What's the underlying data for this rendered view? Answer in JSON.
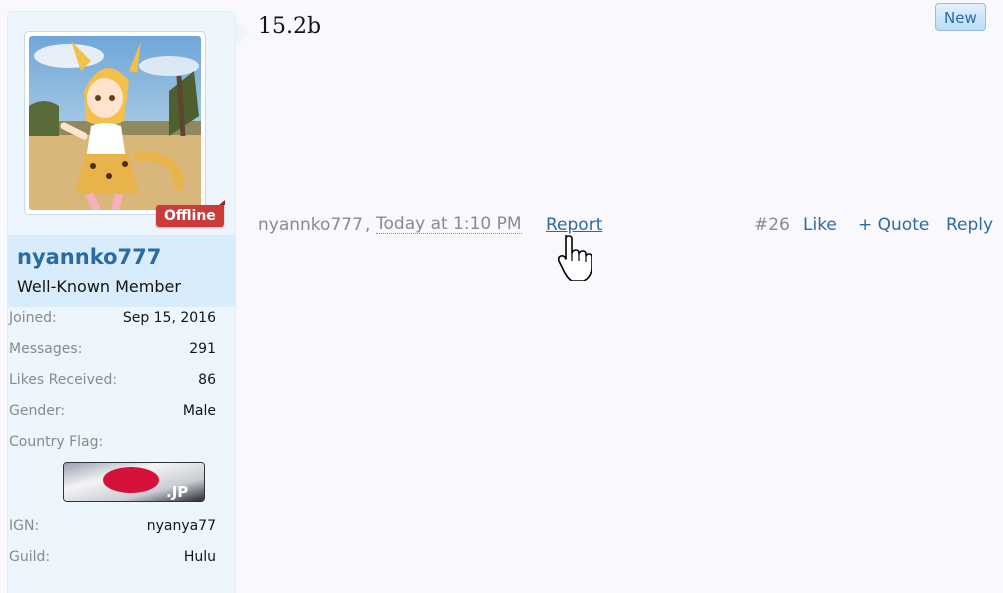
{
  "user": {
    "username": "nyannko777",
    "title": "Well-Known Member",
    "status_badge": "Offline",
    "extras": [
      {
        "label": "Joined:",
        "value": "Sep 15, 2016"
      },
      {
        "label": "Messages:",
        "value": "291"
      },
      {
        "label": "Likes Received:",
        "value": "86"
      },
      {
        "label": "Gender:",
        "value": "Male"
      },
      {
        "label": "Country Flag:",
        "value": ""
      }
    ],
    "extras_after_flag": [
      {
        "label": "IGN:",
        "value": "nyanya77"
      },
      {
        "label": "Guild:",
        "value": "Hulu"
      }
    ],
    "flag_code": ".JP"
  },
  "message": {
    "text": "15.2b",
    "new_badge": "New",
    "author": "nyannko777",
    "separator": ",",
    "time": "Today at 1:10 PM",
    "report_label": "Report",
    "post_number": "#26",
    "like_label": "Like",
    "quote_label": "+ Quote",
    "reply_label": "Reply"
  },
  "colors": {
    "link": "#2b6aa4",
    "offline_badge": "#cc3b3b",
    "sidebar_bg": "#edf6fd"
  }
}
